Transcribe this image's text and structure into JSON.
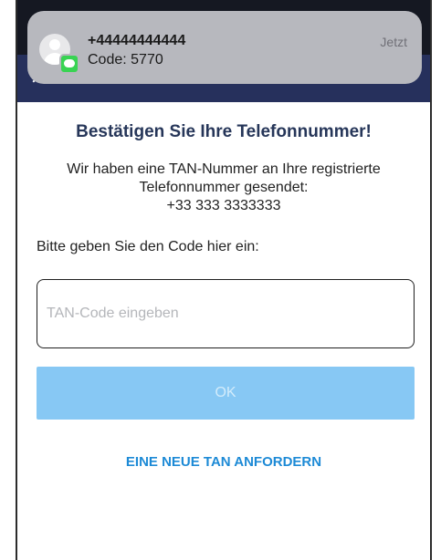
{
  "notification": {
    "sender": "+44444444444",
    "message": "Code: 5770",
    "time": "Jetzt",
    "app_icon": "messages-icon",
    "avatar_icon": "contact-avatar-icon"
  },
  "nav": {
    "close_icon": "close-icon"
  },
  "verification": {
    "title": "Bestätigen Sie Ihre Telefonnummer!",
    "info_line1": "Wir haben eine TAN-Nummer an Ihre registrierte",
    "info_line2": "Telefonnummer gesendet:",
    "phone_number": "+33 333 3333333",
    "prompt": "Bitte geben Sie den Code hier ein:",
    "input_value": "",
    "input_placeholder": "TAN-Code eingeben",
    "ok_label": "OK",
    "request_new_label": "EINE NEUE TAN ANFORDERN"
  },
  "colors": {
    "nav_bar": "#26305c",
    "title_text": "#263659",
    "ok_button_disabled": "#87c8f4",
    "link": "#1d8ad6",
    "notification_bg": "#b7b8be"
  }
}
